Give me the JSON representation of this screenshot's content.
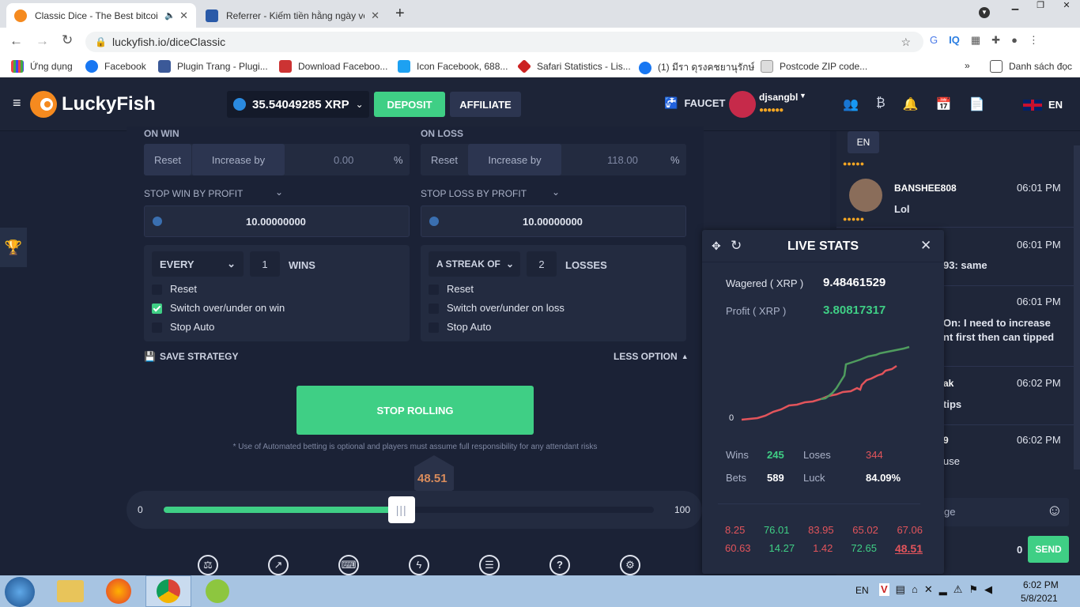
{
  "browser": {
    "tabs": [
      {
        "title": "Classic Dice - The Best bitcoi",
        "active": true
      },
      {
        "title": "Referrer - Kiếm tiền hằng ngày vớ",
        "active": false
      }
    ],
    "url": "luckyfish.io/diceClassic",
    "bookmarks": [
      "Ứng dụng",
      "Facebook",
      "Plugin Trang - Plugi...",
      "Download Faceboo...",
      "Icon Facebook, 688...",
      "Safari Statistics - Lis...",
      "(1) มีรา ดุรงคชยานุรักษ์",
      "Postcode ZIP code..."
    ],
    "reading_list": "Danh sách đọc"
  },
  "header": {
    "logo": "LuckyFish",
    "balance": "35.54049285 XRP",
    "deposit": "DEPOSIT",
    "affiliate": "AFFILIATE",
    "faucet": "FAUCET",
    "username": "djsangbl",
    "language": "EN"
  },
  "auto": {
    "on_win_label": "ON WIN",
    "on_loss_label": "ON LOSS",
    "reset": "Reset",
    "increase_by": "Increase by",
    "win_increase_value": "0.00",
    "loss_increase_value": "118.00",
    "percent": "%",
    "stop_win_label": "STOP WIN BY PROFIT",
    "stop_loss_label": "STOP LOSS BY PROFIT",
    "stop_win_value": "10.00000000",
    "stop_loss_value": "10.00000000",
    "win_rule": {
      "mode": "EVERY",
      "count": "1",
      "unit": "WINS"
    },
    "loss_rule": {
      "mode": "A STREAK OF",
      "count": "2",
      "unit": "LOSSES"
    },
    "win_options": [
      "Reset",
      "Switch over/under on win",
      "Stop Auto"
    ],
    "loss_options": [
      "Reset",
      "Switch over/under on loss",
      "Stop Auto"
    ],
    "save_strategy": "SAVE STRATEGY",
    "less_option": "LESS OPTION",
    "stop_rolling": "STOP ROLLING",
    "disclaimer": "* Use of Automated betting is optional and players must assume full responsibility for any attendant risks"
  },
  "slider": {
    "result": "48.51",
    "min": "0",
    "max": "100",
    "position": 48.5
  },
  "live_stats": {
    "title": "LIVE STATS",
    "wagered_label": "Wagered ( XRP )",
    "wagered": "9.48461529",
    "profit_label": "Profit ( XRP )",
    "profit": "3.80817317",
    "zero_label": "0",
    "wins_label": "Wins",
    "wins": "245",
    "loses_label": "Loses",
    "loses": "344",
    "bets_label": "Bets",
    "bets": "589",
    "luck_label": "Luck",
    "luck": "84.09%",
    "history_row1": [
      "8.25",
      "76.01",
      "83.95",
      "65.02",
      "67.06"
    ],
    "history_row2": [
      "60.63",
      "14.27",
      "1.42",
      "72.65",
      "48.51"
    ]
  },
  "chat": {
    "lang": "EN",
    "messages": [
      {
        "user": "BANSHEE808",
        "time": "06:01 PM",
        "text": "Lol"
      },
      {
        "user": "",
        "time": "06:01 PM",
        "text": "93: same"
      },
      {
        "user": "",
        "time": "06:01 PM",
        "text": "On:  I need to increase nt first then can tipped"
      },
      {
        "user": "ak",
        "time": "06:02 PM",
        "text": "tips"
      },
      {
        "user": "9",
        "time": "06:02 PM",
        "text": "use"
      }
    ],
    "input_placeholder": "ge",
    "counter": "0",
    "send": "SEND"
  },
  "taskbar": {
    "lang": "EN",
    "time": "6:02 PM",
    "date": "5/8/2021"
  },
  "colors": {
    "green": "#3fcf85",
    "red": "#e2545b",
    "bg": "#1b2236",
    "panel": "#232b40"
  }
}
